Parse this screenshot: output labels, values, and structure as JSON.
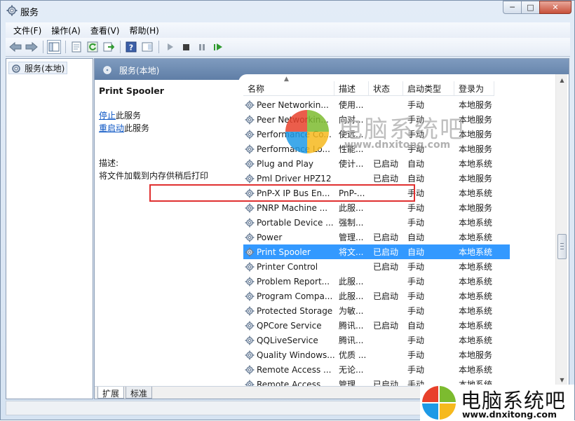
{
  "window": {
    "title": "服务",
    "caption_buttons": {
      "minimize": "─",
      "maximize": "□",
      "close": "✕"
    }
  },
  "menu": {
    "items": [
      "文件(F)",
      "操作(A)",
      "查看(V)",
      "帮助(H)"
    ]
  },
  "toolbar": {
    "icons": [
      "back-arrow-icon",
      "forward-arrow-icon",
      "console-tree-icon",
      "properties-icon",
      "refresh-icon",
      "export-list-icon",
      "help-icon",
      "show-hide-pane-icon",
      "start-service-icon",
      "stop-service-icon",
      "pause-service-icon",
      "restart-service-icon"
    ]
  },
  "tree": {
    "root_label": "服务(本地)"
  },
  "main": {
    "header_title": "服务(本地)",
    "selected_service": "Print Spooler",
    "actions": [
      {
        "link": "停止",
        "suffix": "此服务"
      },
      {
        "link": "重启动",
        "suffix": "此服务"
      }
    ],
    "description_label": "描述:",
    "description_text": "将文件加载到内存供稍后打印"
  },
  "columns": [
    "名称",
    "描述",
    "状态",
    "启动类型",
    "登录为"
  ],
  "rows": [
    {
      "name": "Peer Networkin...",
      "desc": "使用...",
      "status": "",
      "start": "手动",
      "logon": "本地服务"
    },
    {
      "name": "Peer Networkin...",
      "desc": "向对...",
      "status": "",
      "start": "手动",
      "logon": "本地服务"
    },
    {
      "name": "Performance Co...",
      "desc": "使远...",
      "status": "",
      "start": "手动",
      "logon": "本地服务"
    },
    {
      "name": "Performance Lo...",
      "desc": "性能...",
      "status": "",
      "start": "手动",
      "logon": "本地服务"
    },
    {
      "name": "Plug and Play",
      "desc": "使计...",
      "status": "已启动",
      "start": "自动",
      "logon": "本地系统"
    },
    {
      "name": "Pml Driver HPZ12",
      "desc": "",
      "status": "已启动",
      "start": "自动",
      "logon": "本地服务"
    },
    {
      "name": "PnP-X IP Bus En...",
      "desc": "PnP-...",
      "status": "",
      "start": "手动",
      "logon": "本地系统"
    },
    {
      "name": "PNRP Machine ...",
      "desc": "此服...",
      "status": "",
      "start": "手动",
      "logon": "本地服务"
    },
    {
      "name": "Portable Device ...",
      "desc": "强制...",
      "status": "",
      "start": "手动",
      "logon": "本地系统"
    },
    {
      "name": "Power",
      "desc": "管理...",
      "status": "已启动",
      "start": "自动",
      "logon": "本地系统"
    },
    {
      "name": "Print Spooler",
      "desc": "将文...",
      "status": "已启动",
      "start": "自动",
      "logon": "本地系统",
      "selected": true
    },
    {
      "name": "Printer Control",
      "desc": "",
      "status": "已启动",
      "start": "手动",
      "logon": "本地系统"
    },
    {
      "name": "Problem Report...",
      "desc": "此服...",
      "status": "",
      "start": "手动",
      "logon": "本地系统"
    },
    {
      "name": "Program Compa...",
      "desc": "此服...",
      "status": "已启动",
      "start": "手动",
      "logon": "本地系统"
    },
    {
      "name": "Protected Storage",
      "desc": "为敏...",
      "status": "",
      "start": "手动",
      "logon": "本地系统"
    },
    {
      "name": "QPCore Service",
      "desc": "腾讯...",
      "status": "已启动",
      "start": "自动",
      "logon": "本地系统"
    },
    {
      "name": "QQLiveService",
      "desc": "腾讯...",
      "status": "",
      "start": "手动",
      "logon": "本地系统"
    },
    {
      "name": "Quality Windows...",
      "desc": "优质 ...",
      "status": "",
      "start": "手动",
      "logon": "本地服务"
    },
    {
      "name": "Remote Access ...",
      "desc": "无论...",
      "status": "",
      "start": "手动",
      "logon": "本地系统"
    },
    {
      "name": "Remote Access ...",
      "desc": "管理...",
      "status": "已启动",
      "start": "手动",
      "logon": "本地系统"
    }
  ],
  "tabs": [
    "扩展",
    "标准"
  ],
  "watermark": {
    "center_cn": "电脑系统吧",
    "center_url": "www.dnxitong.com",
    "corner_cn": "电脑系统吧",
    "corner_url": "www.dnxitong.com"
  },
  "colors": {
    "selection": "#3399ff",
    "highlight_box": "#e03030",
    "header_bar": "#6f8db3",
    "link": "#0b55c4"
  }
}
